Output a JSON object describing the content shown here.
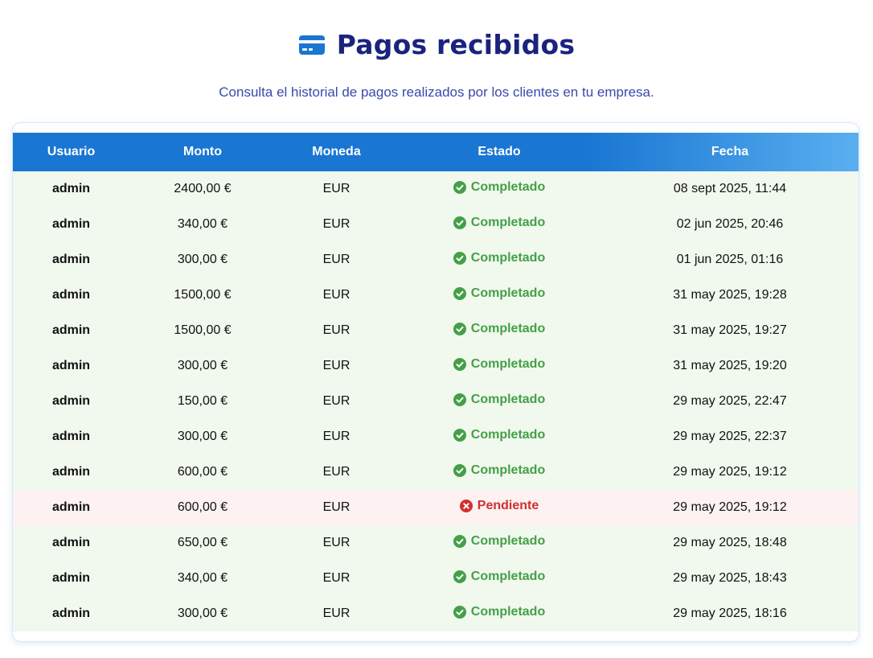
{
  "header": {
    "title": "Pagos recibidos",
    "title_icon": "credit-card-icon",
    "subtitle": "Consulta el historial de pagos realizados por los clientes en tu empresa."
  },
  "colors": {
    "title": "#1a237e",
    "subtitle": "#3949ab",
    "header_bg": "#1976d2",
    "completed": "#43a047",
    "pending": "#d32f2f",
    "completed_row": "#f1f8ee",
    "pending_row": "#fdf1f1"
  },
  "table": {
    "columns": [
      "Usuario",
      "Monto",
      "Moneda",
      "Estado",
      "Fecha"
    ],
    "rows": [
      {
        "user": "admin",
        "amount": "2400,00 €",
        "currency": "EUR",
        "status": "Completado",
        "status_type": "completed",
        "date": "08 sept 2025, 11:44"
      },
      {
        "user": "admin",
        "amount": "340,00 €",
        "currency": "EUR",
        "status": "Completado",
        "status_type": "completed",
        "date": "02 jun 2025, 20:46"
      },
      {
        "user": "admin",
        "amount": "300,00 €",
        "currency": "EUR",
        "status": "Completado",
        "status_type": "completed",
        "date": "01 jun 2025, 01:16"
      },
      {
        "user": "admin",
        "amount": "1500,00 €",
        "currency": "EUR",
        "status": "Completado",
        "status_type": "completed",
        "date": "31 may 2025, 19:28"
      },
      {
        "user": "admin",
        "amount": "1500,00 €",
        "currency": "EUR",
        "status": "Completado",
        "status_type": "completed",
        "date": "31 may 2025, 19:27"
      },
      {
        "user": "admin",
        "amount": "300,00 €",
        "currency": "EUR",
        "status": "Completado",
        "status_type": "completed",
        "date": "31 may 2025, 19:20"
      },
      {
        "user": "admin",
        "amount": "150,00 €",
        "currency": "EUR",
        "status": "Completado",
        "status_type": "completed",
        "date": "29 may 2025, 22:47"
      },
      {
        "user": "admin",
        "amount": "300,00 €",
        "currency": "EUR",
        "status": "Completado",
        "status_type": "completed",
        "date": "29 may 2025, 22:37"
      },
      {
        "user": "admin",
        "amount": "600,00 €",
        "currency": "EUR",
        "status": "Completado",
        "status_type": "completed",
        "date": "29 may 2025, 19:12"
      },
      {
        "user": "admin",
        "amount": "600,00 €",
        "currency": "EUR",
        "status": "Pendiente",
        "status_type": "pending",
        "date": "29 may 2025, 19:12"
      },
      {
        "user": "admin",
        "amount": "650,00 €",
        "currency": "EUR",
        "status": "Completado",
        "status_type": "completed",
        "date": "29 may 2025, 18:48"
      },
      {
        "user": "admin",
        "amount": "340,00 €",
        "currency": "EUR",
        "status": "Completado",
        "status_type": "completed",
        "date": "29 may 2025, 18:43"
      },
      {
        "user": "admin",
        "amount": "300,00 €",
        "currency": "EUR",
        "status": "Completado",
        "status_type": "completed",
        "date": "29 may 2025, 18:16"
      }
    ]
  }
}
